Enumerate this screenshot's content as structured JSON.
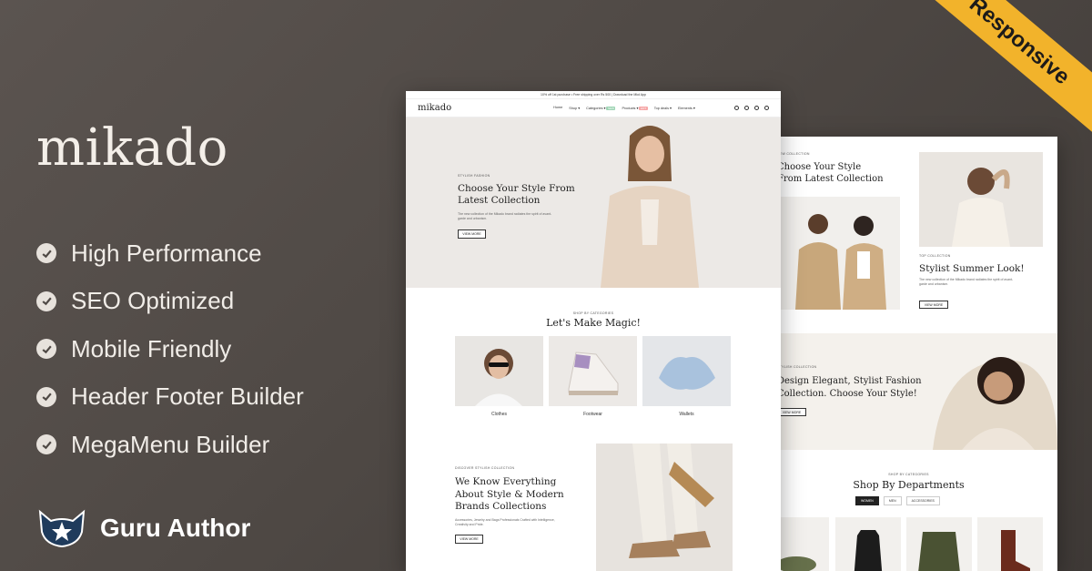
{
  "brand": "mikado",
  "features": [
    "High Performance",
    "SEO Optimized",
    "Mobile Friendly",
    "Header Footer Builder",
    "MegaMenu Builder"
  ],
  "author": "Guru Author",
  "ribbon": "Responsive",
  "colors": {
    "accent": "#f2b32b",
    "background": "#4f4945",
    "badge_green": "#9ed4b4",
    "badge_red": "#f6a7a7"
  },
  "front": {
    "topbar": "10% off 1st purchase • Free shipping over Rs 500 | Download the Mkd App",
    "logo": "mikado",
    "menu": [
      {
        "label": "Home",
        "badge": ""
      },
      {
        "label": "Shop ▾",
        "badge": ""
      },
      {
        "label": "Categories ▾",
        "badge": "NEW"
      },
      {
        "label": "Products ▾",
        "badge": "HOT"
      },
      {
        "label": "Top deals ▾",
        "badge": ""
      },
      {
        "label": "Elements ▾",
        "badge": ""
      }
    ],
    "hero": {
      "eyebrow": "Stylish Fashion",
      "title": "Choose Your Style From Latest Collection",
      "text": "The new collection of the Mikado brand radiates the spirit of avant-garde and urbanism.",
      "button": "View More"
    },
    "categories": {
      "eyebrow": "Shop by categories",
      "title": "Let's Make Magic!",
      "items": [
        "Clothes",
        "Footwear",
        "Wallets"
      ]
    },
    "story": {
      "eyebrow": "Discover Stylish Collection",
      "title": "We Know Everything About Style & Modern Brands Collections",
      "text": "Accessories, Jewelry and Bags Professionals Crafted with Intelligence, Creativity and Pride.",
      "button": "View More"
    }
  },
  "back": {
    "promo1": {
      "eyebrow": "New Collection",
      "title": "Choose Your Style From Latest Collection"
    },
    "promo2": {
      "eyebrow": "Top Collection",
      "title": "Stylist Summer Look!",
      "text": "The new collection of the Mikado brand radiates the spirit of avant-garde and urbanism.",
      "button": "View More"
    },
    "banner": {
      "eyebrow": "Stylish Collection",
      "title": "Design Elegant, Stylist Fashion Collection. Choose Your Style!",
      "button": "View More"
    },
    "departments": {
      "eyebrow": "Shop by categories",
      "title": "Shop By Departments",
      "tabs": [
        "Women",
        "Men",
        "Accessories"
      ]
    }
  }
}
